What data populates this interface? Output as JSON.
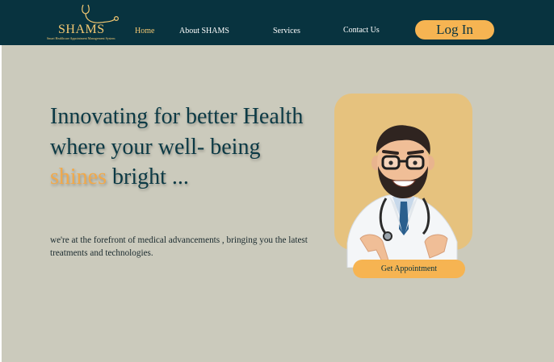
{
  "logo": {
    "wordmark": "SHAMS",
    "tagline": "Smart Healthcare Appointment Management System"
  },
  "nav": {
    "items": [
      {
        "label": "Home",
        "active": true
      },
      {
        "label": "About SHAMS",
        "active": false
      },
      {
        "label": "Services",
        "active": false
      },
      {
        "label": "Contact Us",
        "active": false
      }
    ],
    "login_label": "Log In"
  },
  "hero": {
    "headline_pre": "Innovating for better Health where your well- being ",
    "headline_accent": "shines",
    "headline_post": " bright ...",
    "subtext": "we're at the forefront of medical advancements , bringing you the latest treatments and technologies.",
    "cta_label": "Get Appointment"
  },
  "colors": {
    "navbar": "#08333f",
    "page_background": "#cbcabc",
    "accent": "#f6b452",
    "headline": "#0c3a45",
    "card": "#e6c27e"
  },
  "icons": {
    "logo_mark": "stethoscope-icon",
    "illustration": "doctor-illustration"
  }
}
